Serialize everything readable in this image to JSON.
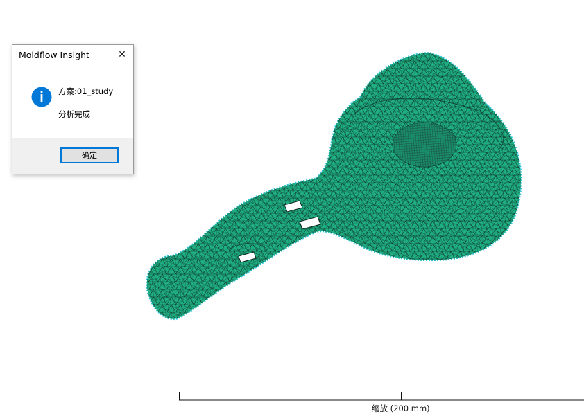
{
  "dialog": {
    "title": "Moldflow Insight",
    "close_symbol": "✕",
    "icon": "info-icon",
    "icon_glyph": "i",
    "message_line1": "方案:01_study",
    "message_line2": "分析完成",
    "ok_label": "确定"
  },
  "scale_bar": {
    "label": "缩放 (200 mm)"
  },
  "colors": {
    "mesh_fill": "#1fae82",
    "mesh_edge": "#0a0a0a",
    "mesh_outline": "#28c4d8",
    "accent": "#0078d7"
  }
}
